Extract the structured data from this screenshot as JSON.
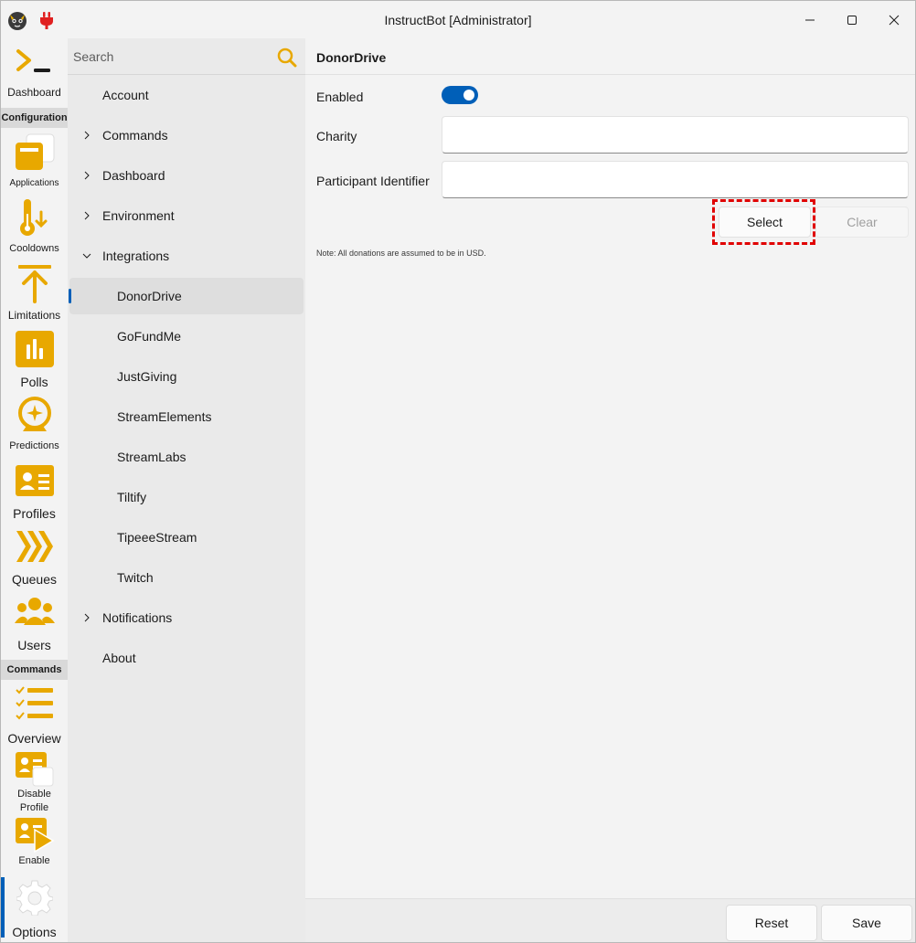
{
  "window": {
    "title": "InstructBot [Administrator]"
  },
  "rail": {
    "items": [
      {
        "label": "Dashboard",
        "icon": "terminal-icon"
      },
      {
        "label": "Applications",
        "icon": "applications-icon"
      },
      {
        "label": "Cooldowns",
        "icon": "thermometer-icon"
      },
      {
        "label": "Limitations",
        "icon": "arrow-up-icon"
      },
      {
        "label": "Polls",
        "icon": "poll-chart-icon"
      },
      {
        "label": "Predictions",
        "icon": "prediction-icon"
      },
      {
        "label": "Profiles",
        "icon": "profile-card-icon"
      },
      {
        "label": "Queues",
        "icon": "queue-chevrons-icon"
      },
      {
        "label": "Users",
        "icon": "users-icon"
      },
      {
        "label": "Overview",
        "icon": "list-icon"
      },
      {
        "label_line1": "Disable",
        "label_line2": "Profile",
        "icon": "disable-profile-icon"
      },
      {
        "label": "Enable",
        "icon": "enable-profile-icon"
      },
      {
        "label": "Options",
        "icon": "gear-icon"
      }
    ],
    "sections": {
      "configuration": "Configuration",
      "commands": "Commands"
    }
  },
  "nav": {
    "search_placeholder": "Search",
    "items": [
      {
        "label": "Account"
      },
      {
        "label": "Commands"
      },
      {
        "label": "Dashboard"
      },
      {
        "label": "Environment"
      },
      {
        "label": "Integrations"
      },
      {
        "label": "DonorDrive"
      },
      {
        "label": "GoFundMe"
      },
      {
        "label": "JustGiving"
      },
      {
        "label": "StreamElements"
      },
      {
        "label": "StreamLabs"
      },
      {
        "label": "Tiltify"
      },
      {
        "label": "TipeeeStream"
      },
      {
        "label": "Twitch"
      },
      {
        "label": "Notifications"
      },
      {
        "label": "About"
      }
    ]
  },
  "content": {
    "title": "DonorDrive",
    "enabled_label": "Enabled",
    "charity_label": "Charity",
    "charity_value": "",
    "participant_label": "Participant Identifier",
    "participant_value": "",
    "select_label": "Select",
    "clear_label": "Clear",
    "note": "Note: All donations are assumed to be in USD."
  },
  "footer": {
    "reset_label": "Reset",
    "save_label": "Save"
  },
  "colors": {
    "accent": "#005fb8",
    "icon_gold": "#e8a800",
    "highlight": "#e00000"
  }
}
